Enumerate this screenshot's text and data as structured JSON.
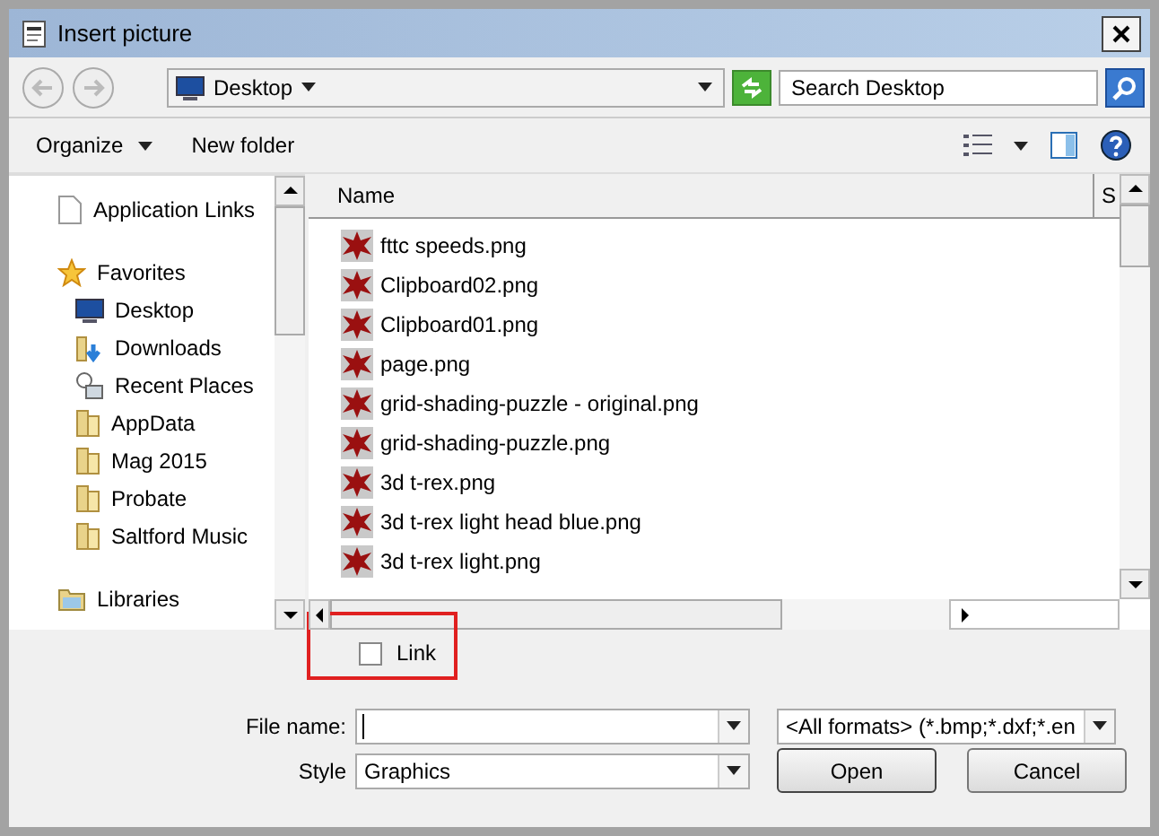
{
  "window": {
    "title": "Insert picture"
  },
  "address_bar": {
    "location": "Desktop"
  },
  "search": {
    "placeholder": "Search Desktop"
  },
  "toolbar": [
    {
      "label": "Organize",
      "kind": "menu"
    },
    {
      "label": "New folder",
      "kind": "button"
    }
  ],
  "navigation": [
    {
      "label": "Application Links",
      "kind": "file"
    },
    {
      "label": "Favorites",
      "kind": "star",
      "children": [
        {
          "label": "Desktop",
          "kind": "desktop"
        },
        {
          "label": "Downloads",
          "kind": "downloads"
        },
        {
          "label": "Recent Places",
          "kind": "recent"
        },
        {
          "label": "AppData",
          "kind": "folder"
        },
        {
          "label": "Mag 2015",
          "kind": "folder"
        },
        {
          "label": "Probate",
          "kind": "folder"
        },
        {
          "label": "Saltford Music",
          "kind": "folder"
        }
      ]
    },
    {
      "label": "Libraries",
      "kind": "library"
    }
  ],
  "columns": [
    {
      "label": "Name"
    },
    {
      "label": "S"
    }
  ],
  "files": [
    "fttc speeds.png",
    "Clipboard02.png",
    "Clipboard01.png",
    "page.png",
    "grid-shading-puzzle - original.png",
    "grid-shading-puzzle.png",
    "3d t-rex.png",
    "3d t-rex light head blue.png",
    "3d t-rex light.png"
  ],
  "link_checkbox": {
    "label": "Link",
    "checked": false
  },
  "file_name": {
    "label": "File name:"
  },
  "file_type": {
    "value": "<All formats> (*.bmp;*.dxf;*.en"
  },
  "style": {
    "label": "Style",
    "value": "Graphics"
  },
  "buttons": [
    "Open",
    "Cancel"
  ]
}
